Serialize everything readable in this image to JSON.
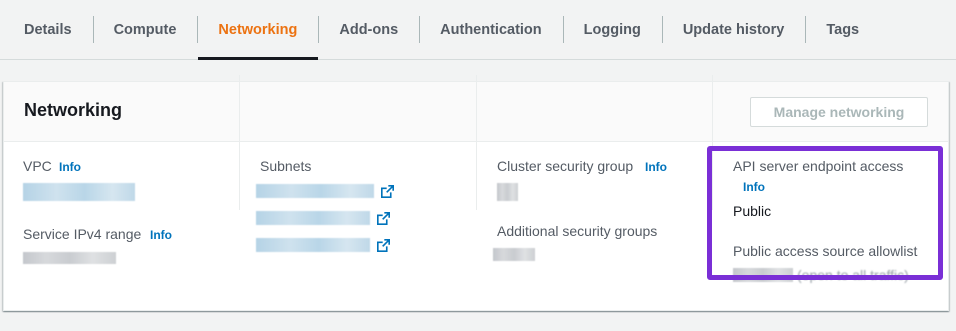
{
  "tabs": [
    {
      "label": "Details"
    },
    {
      "label": "Compute"
    },
    {
      "label": "Networking",
      "active": true
    },
    {
      "label": "Add-ons"
    },
    {
      "label": "Authentication"
    },
    {
      "label": "Logging"
    },
    {
      "label": "Update history"
    },
    {
      "label": "Tags"
    }
  ],
  "panel": {
    "title": "Networking",
    "manage_button": "Manage networking"
  },
  "fields": {
    "vpc": {
      "label": "VPC",
      "info": "Info"
    },
    "service_ipv4": {
      "label": "Service IPv4 range",
      "info": "Info"
    },
    "subnets": {
      "label": "Subnets"
    },
    "cluster_sg": {
      "label": "Cluster security group",
      "info": "Info"
    },
    "additional_sg": {
      "label": "Additional security groups"
    },
    "api_endpoint": {
      "label": "API server endpoint access",
      "info": "Info",
      "value": "Public"
    },
    "public_allowlist": {
      "label": "Public access source allowlist",
      "value_suffix": "(open to all traffic)"
    }
  },
  "colors": {
    "accent_tab": "#ec7211",
    "link": "#0073bb",
    "highlight": "#7a2fd6"
  }
}
